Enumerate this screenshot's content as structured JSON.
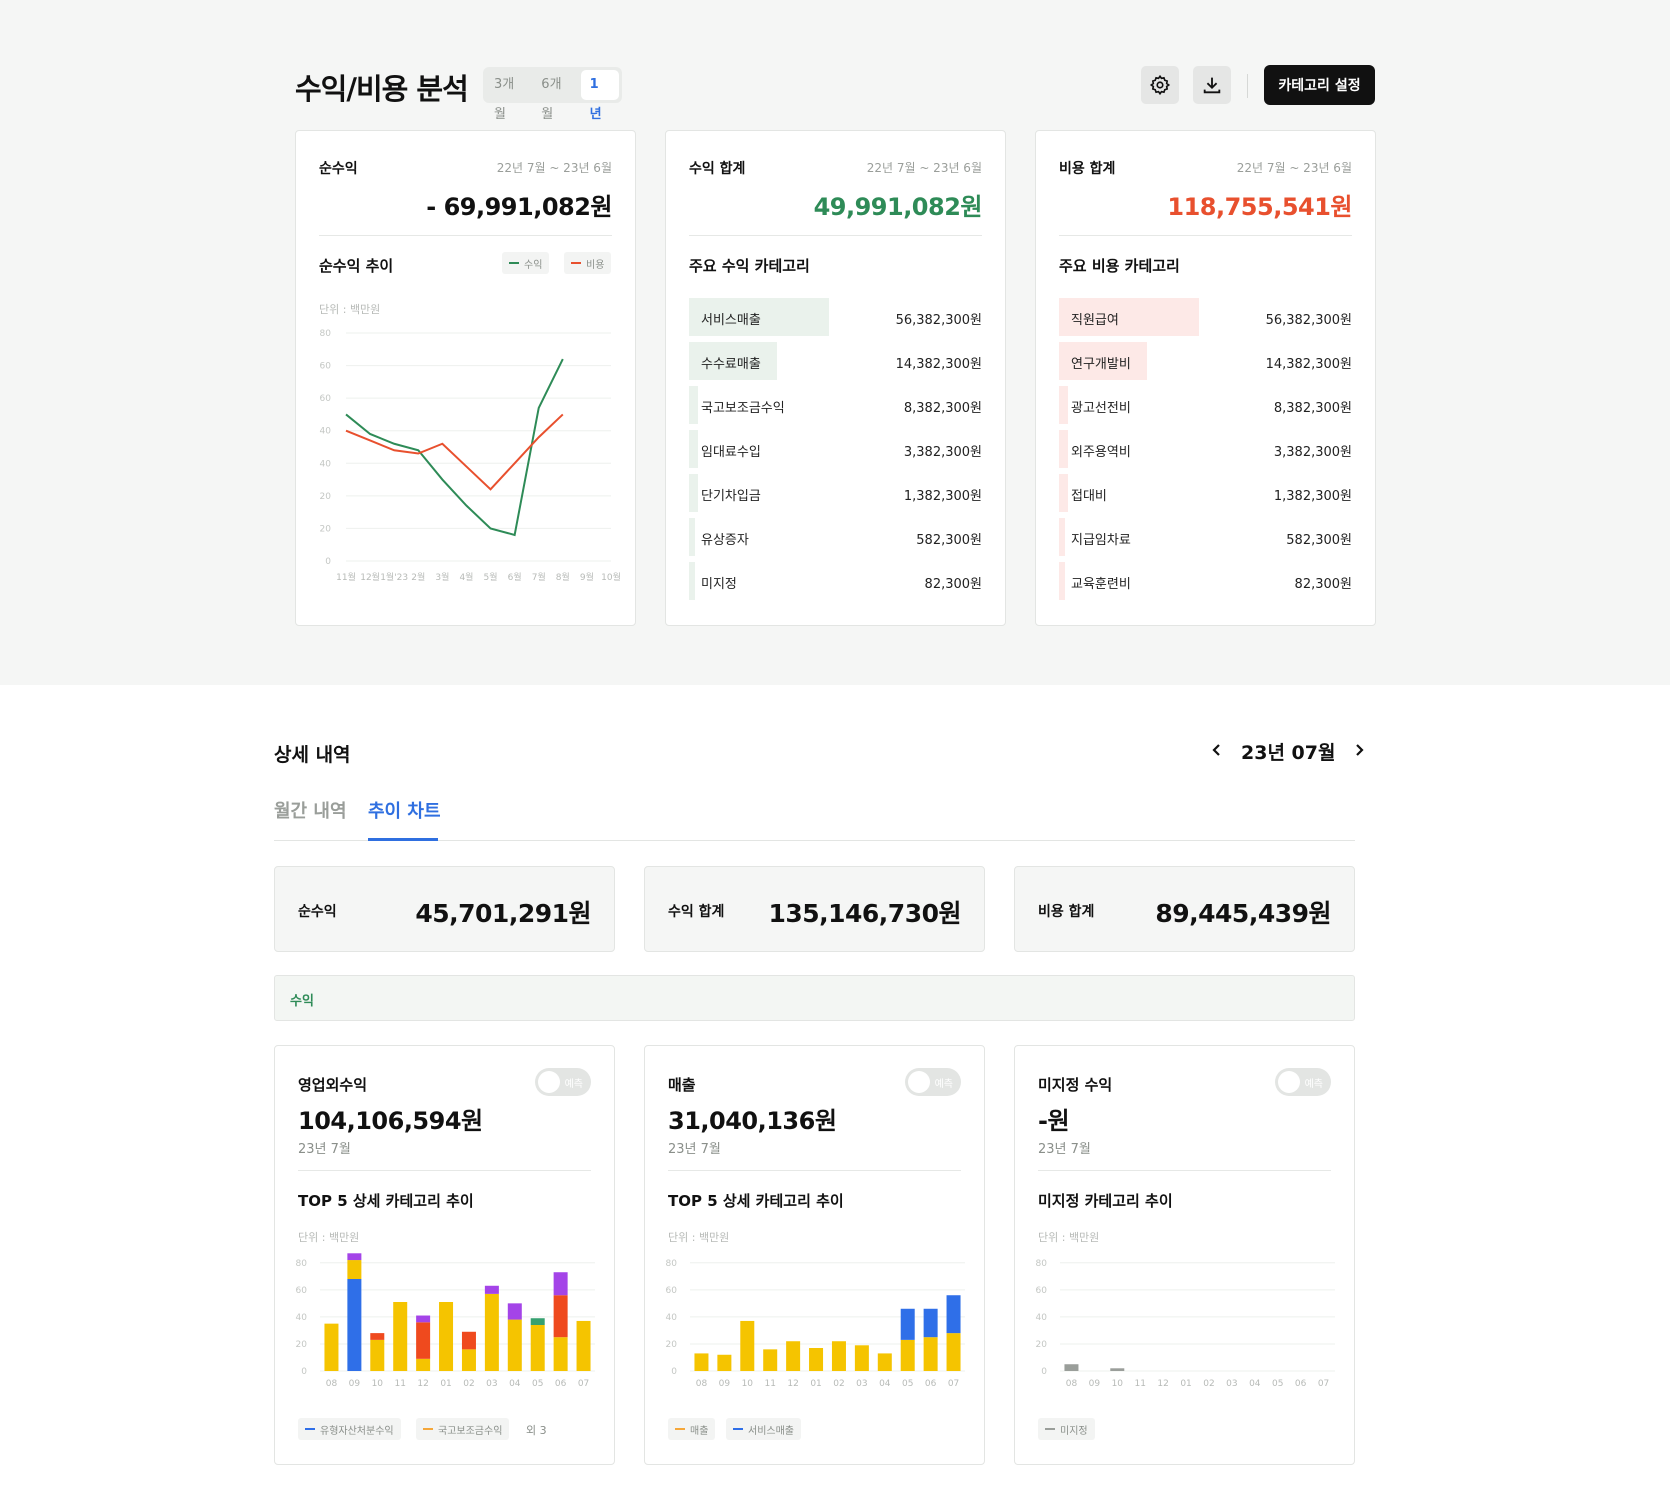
{
  "header": {
    "title": "수익/비용 분석",
    "periods": [
      "3개월",
      "6개월",
      "1년"
    ],
    "active_period": "1년",
    "category_button": "카테고리 설정"
  },
  "net_card": {
    "label": "순수익",
    "date": "22년 7월 ~ 23년 6월",
    "value": "- 69,991,082원",
    "trend_title": "순수익 추이",
    "legend": [
      "수익",
      "비용"
    ],
    "unit": "단위 : 백만원"
  },
  "revenue_card": {
    "label": "수익 합계",
    "date": "22년 7월 ~ 23년 6월",
    "value": "49,991,082원",
    "sub_title": "주요 수익 카테고리",
    "rows": [
      {
        "name": "서비스매출",
        "value": "56,382,300원",
        "fill": 0.48
      },
      {
        "name": "수수료매출",
        "value": "14,382,300원",
        "fill": 0.3
      },
      {
        "name": "국고보조금수익",
        "value": "8,382,300원",
        "fill": 0.03
      },
      {
        "name": "임대료수입",
        "value": "3,382,300원",
        "fill": 0.03
      },
      {
        "name": "단기차입금",
        "value": "1,382,300원",
        "fill": 0.03
      },
      {
        "name": "유상증자",
        "value": "582,300원",
        "fill": 0.02
      },
      {
        "name": "미지정",
        "value": "82,300원",
        "fill": 0.02
      }
    ]
  },
  "expense_card": {
    "label": "비용 합계",
    "date": "22년 7월 ~ 23년 6월",
    "value": "118,755,541원",
    "sub_title": "주요 비용 카테고리",
    "rows": [
      {
        "name": "직원급여",
        "value": "56,382,300원",
        "fill": 0.48
      },
      {
        "name": "연구개발비",
        "value": "14,382,300원",
        "fill": 0.3
      },
      {
        "name": "광고선전비",
        "value": "8,382,300원",
        "fill": 0.03
      },
      {
        "name": "외주용역비",
        "value": "3,382,300원",
        "fill": 0.03
      },
      {
        "name": "접대비",
        "value": "1,382,300원",
        "fill": 0.03
      },
      {
        "name": "지급임차료",
        "value": "582,300원",
        "fill": 0.02
      },
      {
        "name": "교육훈련비",
        "value": "82,300원",
        "fill": 0.02
      }
    ]
  },
  "colors": {
    "revenue": "#2e8b57",
    "expense": "#e8502e",
    "tab_active": "#2f6fe0",
    "blue": "#2f6fe8",
    "yellow": "#f5c400",
    "red": "#ef4a1e",
    "purple": "#a444e8",
    "green": "#36a070",
    "orange": "#f5a73a",
    "gray": "#9a9e9a"
  },
  "detail": {
    "title": "상세 내역",
    "month": "23년 07월",
    "tabs": [
      "월간 내역",
      "추이 차트"
    ],
    "active_tab": "추이 차트",
    "summary": [
      {
        "label": "순수익",
        "value": "45,701,291원"
      },
      {
        "label": "수익 합계",
        "value": "135,146,730원"
      },
      {
        "label": "비용 합계",
        "value": "89,445,439원"
      }
    ],
    "section_label": "수익"
  },
  "bottom_cards": [
    {
      "label": "영업외수익",
      "value": "104,106,594원",
      "date": "23년 7월",
      "toggle": "예측",
      "chart_title": "TOP 5 상세 카테고리 추이",
      "unit": "단위 : 백만원",
      "legend": [
        {
          "name": "유형자산처분수익",
          "color": "#2f6fe8"
        },
        {
          "name": "국고보조금수익",
          "color": "#f5a73a"
        }
      ],
      "legend_more": "외 3"
    },
    {
      "label": "매출",
      "value": "31,040,136원",
      "date": "23년 7월",
      "toggle": "예측",
      "chart_title": "TOP 5 상세 카테고리 추이",
      "unit": "단위 : 백만원",
      "legend": [
        {
          "name": "매출",
          "color": "#f5a73a"
        },
        {
          "name": "서비스매출",
          "color": "#2f6fe8"
        }
      ],
      "legend_more": ""
    },
    {
      "label": "미지정 수익",
      "value": "-원",
      "date": "23년 7월",
      "toggle": "예측",
      "chart_title": "미지정 카테고리 추이",
      "unit": "단위 : 백만원",
      "legend": [
        {
          "name": "미지정",
          "color": "#9a9e9a"
        }
      ],
      "legend_more": ""
    }
  ],
  "chart_data": [
    {
      "type": "line",
      "x": [
        "11월",
        "12월",
        "1월'23",
        "2월",
        "3월",
        "4월",
        "5월",
        "6월",
        "7월",
        "8월",
        "9월",
        "10월"
      ],
      "y_ticks": [
        "0",
        "20",
        "20",
        "40",
        "40",
        "60",
        "60",
        "80"
      ],
      "ylim": [
        0,
        70
      ],
      "series": [
        {
          "name": "수익",
          "values": [
            45,
            39,
            36,
            34,
            25,
            17,
            10,
            8,
            47,
            62,
            62,
            62
          ]
        },
        {
          "name": "비용",
          "values": [
            40,
            37,
            34,
            33,
            36,
            29,
            22,
            30,
            38,
            45,
            52,
            55
          ]
        }
      ]
    },
    {
      "type": "bar",
      "stacked": true,
      "categories": [
        "08",
        "09",
        "10",
        "11",
        "12",
        "01",
        "02",
        "03",
        "04",
        "05",
        "06",
        "07"
      ],
      "y_ticks": [
        "0",
        "20",
        "40",
        "60",
        "80"
      ],
      "ylim": [
        0,
        85
      ],
      "series": [
        {
          "name": "유형자산처분수익",
          "values": [
            0,
            68,
            0,
            0,
            0,
            0,
            0,
            0,
            0,
            0,
            0,
            0
          ]
        },
        {
          "name": "국고보조금수익",
          "values": [
            35,
            14,
            23,
            51,
            9,
            51,
            16,
            57,
            38,
            34,
            25,
            37
          ]
        },
        {
          "name": "red",
          "values": [
            0,
            0,
            5,
            0,
            27,
            0,
            13,
            0,
            0,
            0,
            31,
            0
          ]
        },
        {
          "name": "green",
          "values": [
            0,
            0,
            0,
            0,
            0,
            0,
            0,
            0,
            0,
            5,
            0,
            0
          ]
        },
        {
          "name": "purple",
          "values": [
            0,
            5,
            0,
            0,
            5,
            0,
            0,
            6,
            12,
            0,
            17,
            0
          ]
        }
      ]
    },
    {
      "type": "bar",
      "stacked": true,
      "categories": [
        "08",
        "09",
        "10",
        "11",
        "12",
        "01",
        "02",
        "03",
        "04",
        "05",
        "06",
        "07"
      ],
      "y_ticks": [
        "0",
        "20",
        "40",
        "60",
        "80"
      ],
      "ylim": [
        0,
        85
      ],
      "series": [
        {
          "name": "매출",
          "values": [
            13,
            12,
            37,
            16,
            22,
            17,
            22,
            19,
            13,
            23,
            25,
            28
          ]
        },
        {
          "name": "서비스매출",
          "values": [
            0,
            0,
            0,
            0,
            0,
            0,
            0,
            0,
            0,
            23,
            21,
            28
          ]
        }
      ]
    },
    {
      "type": "bar",
      "stacked": true,
      "categories": [
        "08",
        "09",
        "10",
        "11",
        "12",
        "01",
        "02",
        "03",
        "04",
        "05",
        "06",
        "07"
      ],
      "y_ticks": [
        "0",
        "20",
        "40",
        "60",
        "80"
      ],
      "ylim": [
        0,
        85
      ],
      "series": [
        {
          "name": "미지정",
          "values": [
            5,
            0,
            2,
            0,
            0,
            0,
            0,
            0,
            0,
            0,
            0,
            0
          ]
        }
      ]
    }
  ]
}
